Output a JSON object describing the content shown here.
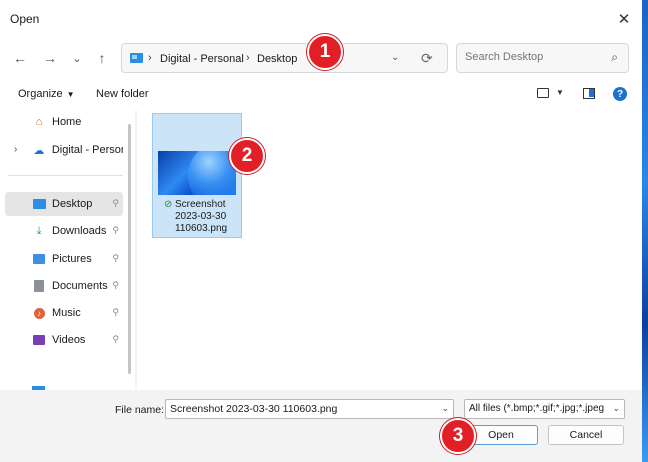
{
  "window": {
    "title": "Open",
    "close_icon": "✕"
  },
  "nav_buttons": {
    "back": "←",
    "forward": "→",
    "recent": "⌄",
    "up": "↑"
  },
  "address_bar": {
    "crumbs": [
      "Digital - Personal",
      "Desktop"
    ],
    "separator": "›",
    "dropdown_icon": "⌄",
    "refresh_icon": "⟳"
  },
  "search": {
    "placeholder": "Search Desktop",
    "icon": "⌕"
  },
  "toolbar": {
    "organize_label": "Organize",
    "new_folder_label": "New folder",
    "help_label": "?"
  },
  "sidebar": {
    "items": [
      {
        "label": "Home",
        "icon": "home-icon",
        "pinned": false
      },
      {
        "label": "Digital - Personal",
        "icon": "cloud-icon",
        "pinned": false
      },
      {
        "label": "Desktop",
        "icon": "desktop-icon",
        "pinned": true
      },
      {
        "label": "Downloads",
        "icon": "download-icon",
        "pinned": true
      },
      {
        "label": "Pictures",
        "icon": "pictures-icon",
        "pinned": true
      },
      {
        "label": "Documents",
        "icon": "documents-icon",
        "pinned": true
      },
      {
        "label": "Music",
        "icon": "music-icon",
        "pinned": true
      },
      {
        "label": "Videos",
        "icon": "videos-icon",
        "pinned": true
      }
    ],
    "selected": "Desktop"
  },
  "files": [
    {
      "name": "Screenshot 2023-03-30 110603.png",
      "name_lines": [
        "Screenshot",
        "2023-03-30",
        "110603.png"
      ],
      "status": "synced",
      "status_icon": "⊘",
      "selected": true
    }
  ],
  "bottom": {
    "file_name_label": "File name:",
    "file_name_value": "Screenshot 2023-03-30 110603.png",
    "file_type_filter": "All files (*.bmp;*.gif;*.jpg;*.jpeg",
    "open_label": "Open",
    "cancel_label": "Cancel"
  },
  "markers": [
    "1",
    "2",
    "3"
  ],
  "colors": {
    "accent": "#1a73d0",
    "marker": "#e21f26",
    "selection": "#cce4f7"
  }
}
